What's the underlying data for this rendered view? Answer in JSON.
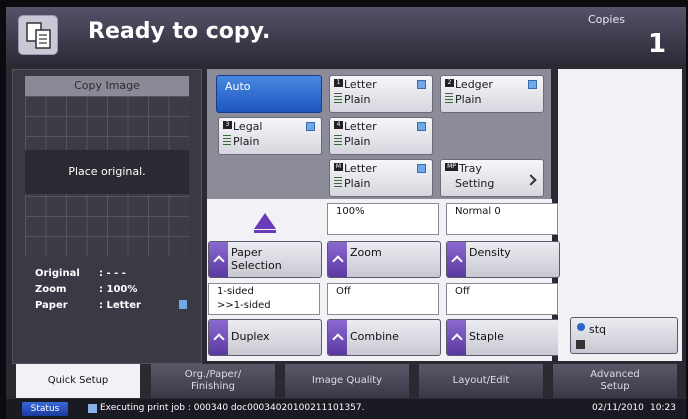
{
  "header": {
    "title": "Ready to copy.",
    "copies_label": "Copies",
    "copies_value": "1"
  },
  "preview": {
    "header": "Copy Image",
    "message": "Place original.",
    "rows": [
      {
        "key": "Original",
        "value": ": - - -"
      },
      {
        "key": "Zoom",
        "value": ": 100%"
      },
      {
        "key": "Paper",
        "value": ": Letter"
      }
    ]
  },
  "trays": {
    "auto": "Auto",
    "t1": {
      "num": "1",
      "size": "Letter",
      "type": "Plain"
    },
    "t2": {
      "num": "2",
      "size": "Ledger",
      "type": "Plain"
    },
    "t3": {
      "num": "3",
      "size": "Legal",
      "type": "Plain"
    },
    "t4": {
      "num": "4",
      "size": "Letter",
      "type": "Plain"
    },
    "t5": {
      "num": "M",
      "size": "Letter",
      "type": "Plain"
    },
    "mp": {
      "num": "MP",
      "line1": "Tray",
      "line2": "Setting"
    }
  },
  "functions": {
    "paper": {
      "label1": "Paper",
      "label2": "Selection"
    },
    "zoom": {
      "value": "100%",
      "label": "Zoom"
    },
    "density": {
      "value": "Normal 0",
      "label": "Density"
    },
    "duplex": {
      "value1": "1-sided",
      "value2": ">>1-sided",
      "label": "Duplex"
    },
    "combine": {
      "value": "Off",
      "label": "Combine"
    },
    "staple": {
      "value": "Off",
      "label": "Staple"
    },
    "stq": {
      "label": "stq"
    }
  },
  "tabs": [
    {
      "line1": "Quick Setup",
      "line2": ""
    },
    {
      "line1": "Org./Paper/",
      "line2": "Finishing"
    },
    {
      "line1": "Image Quality",
      "line2": ""
    },
    {
      "line1": "Layout/Edit",
      "line2": ""
    },
    {
      "line1": "Advanced",
      "line2": "Setup"
    }
  ],
  "status": {
    "button": "Status",
    "message": "Executing print job : 000340 doc00034020100211101357.",
    "date": "02/11/2010",
    "time": "10:23"
  },
  "icons": [
    "copy-icon",
    "paper-icon",
    "tray-stack-icon",
    "chevron-right-icon",
    "paper-selection-triangle-icon",
    "stq-icon",
    "print-job-icon"
  ],
  "colors": {
    "accent_blue": "#1d56c0",
    "function_purple": "#5a3aa0",
    "header_bg": "#3c3a4a"
  }
}
